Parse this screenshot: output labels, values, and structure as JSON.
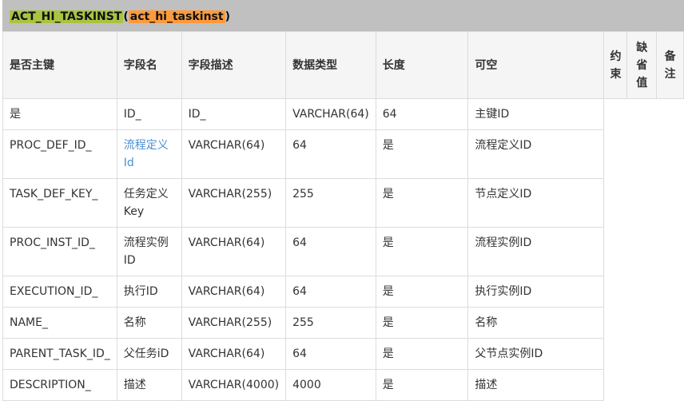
{
  "title": {
    "prefix": "ACT_HI_TASKINST",
    "open": "(",
    "name": "act_hi_taskinst",
    "close": ")"
  },
  "headers": [
    "是否主键",
    "字段名",
    "字段描述",
    "数据类型",
    "长度",
    "可空",
    "约束",
    "缺省值",
    "备注"
  ],
  "rows": [
    [
      "是",
      "ID_",
      "ID_",
      "VARCHAR(64)",
      "64",
      "主键ID"
    ],
    [
      "PROC_DEF_ID_",
      "流程定义Id",
      "VARCHAR(64)",
      "64",
      "是",
      "流程定义ID"
    ],
    [
      "TASK_DEF_KEY_",
      "任务定义Key",
      "VARCHAR(255)",
      "255",
      "是",
      "节点定义ID"
    ],
    [
      "PROC_INST_ID_",
      "流程实例ID",
      "VARCHAR(64)",
      "64",
      "是",
      "流程实例ID"
    ],
    [
      "EXECUTION_ID_",
      "执行ID",
      "VARCHAR(64)",
      "64",
      "是",
      "执行实例ID"
    ],
    [
      "NAME_",
      "名称",
      "VARCHAR(255)",
      "255",
      "是",
      "名称"
    ],
    [
      "PARENT_TASK_ID_",
      "父任务iD",
      "VARCHAR(64)",
      "64",
      "是",
      "父节点实例ID"
    ],
    [
      "DESCRIPTION_",
      "描述",
      "VARCHAR(4000)",
      "4000",
      "是",
      "描述"
    ]
  ],
  "colors": {
    "title_bg": "#c0c0c0",
    "highlight_green": "#a9c441",
    "highlight_orange": "#ff9a3c",
    "link": "#4a8fd0"
  }
}
